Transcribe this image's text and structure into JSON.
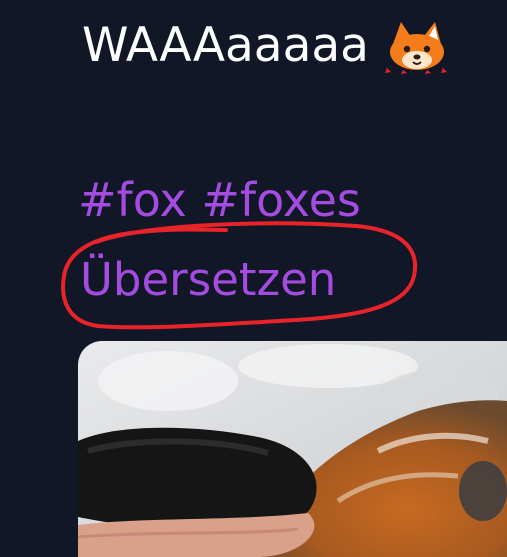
{
  "post": {
    "text": "WAAAaaaaa",
    "emoji_icon": "fox-emoji-icon",
    "hashtags": [
      "#fox",
      "#foxes"
    ],
    "translate_label": "Übersetzen",
    "media_type": "image"
  },
  "colors": {
    "background": "#111726",
    "text": "#ffffff",
    "link": "#a54ce0",
    "annotation": "#e8242a"
  }
}
